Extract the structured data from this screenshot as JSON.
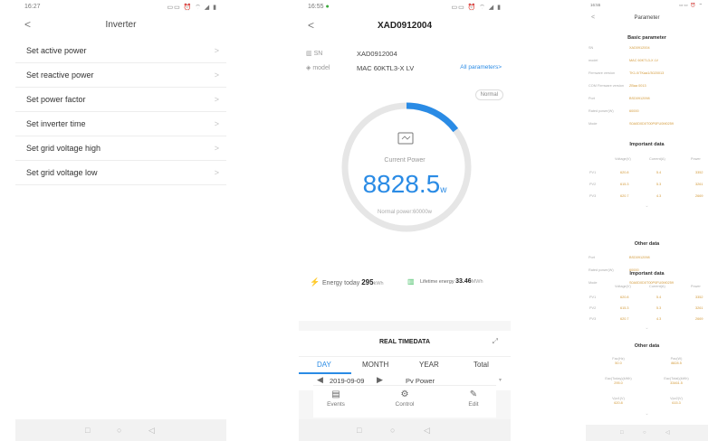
{
  "screen1": {
    "time": "16:27",
    "status_icons": "▭▭ ⏰ ⌔ ◢ ▮",
    "title": "Inverter",
    "back": "<",
    "menu": [
      {
        "label": "Set active power"
      },
      {
        "label": "Set reactive power"
      },
      {
        "label": "Set power factor"
      },
      {
        "label": "Set inverter time"
      },
      {
        "label": "Set grid voltage high"
      },
      {
        "label": "Set grid voltage low"
      }
    ],
    "chevron": ">"
  },
  "screen2": {
    "time": "16:55",
    "status_icons": "▭▭ ⏰ ⌔ ◢ ▮",
    "title": "XAD0912004",
    "back": "<",
    "sn_label": "SN",
    "sn_value": "XAD0912004",
    "model_label": "model",
    "model_value": "MAC 60KTL3-X LV",
    "all_params": "All parameters>",
    "status_badge": "Normal",
    "current_power_label": "Current Power",
    "current_power_value": "8828.5",
    "current_power_unit": "w",
    "normal_power": "Normal power:60000w",
    "gauge_fraction": 0.147,
    "energy_today_label": "Energy today",
    "energy_today_value": "295",
    "energy_today_unit": "kWh",
    "lifetime_label": "Lifetime energy",
    "lifetime_value": "33.46",
    "lifetime_unit": "MWh",
    "realtime_title": "REAL TIMEDATA",
    "tabs": [
      "DAY",
      "MONTH",
      "YEAR",
      "Total"
    ],
    "date": "2019-09-09",
    "series_select": "Pv Power",
    "toolbar": [
      {
        "label": "Events",
        "icon": "events-icon"
      },
      {
        "label": "Control",
        "icon": "gear-icon"
      },
      {
        "label": "Edit",
        "icon": "edit-icon"
      }
    ],
    "accent": "#2a8be5"
  },
  "screen3": {
    "time": "16:55",
    "status_icons": "▭▭ ⏰ ⌔",
    "title": "Parameter",
    "back": "<",
    "basic_title": "Basic parameter",
    "basic": [
      {
        "k": "SN",
        "v": "XAD0912004"
      },
      {
        "k": "model",
        "v": "MAC 60KTL3-X LV"
      },
      {
        "k": "Firmware version",
        "v": "TK1.0/TKaa1/3020013"
      },
      {
        "k": "COM Firmware version",
        "v": "ZBaa 0013"
      },
      {
        "k": "Port",
        "v": "BSD0912098"
      },
      {
        "k": "Rated power(W)",
        "v": "60000"
      },
      {
        "k": "Mode",
        "v": "S0A0D0D0T00P0FU0M0259"
      }
    ],
    "important_title": "Important data",
    "imp_headers": [
      "Voltage(V)",
      "Current(A)",
      "Power"
    ],
    "imp_rows": [
      {
        "name": "PV1",
        "v": "620.8",
        "c": "5.4",
        "p": "3352"
      },
      {
        "name": "PV2",
        "v": "615.3",
        "c": "5.3",
        "p": "3261"
      },
      {
        "name": "PV3",
        "v": "620.7",
        "c": "4.3",
        "p": "2669"
      }
    ],
    "other_title": "Other data",
    "other": [
      {
        "k": "Port",
        "v": "BSD0912098"
      },
      {
        "k": "Rated power(W)",
        "v": "60000"
      },
      {
        "k": "Mode",
        "v": "S0A0D0D0T00P0FU0M0259"
      }
    ],
    "important2_title": "Important data",
    "other2_title": "Other data",
    "grid": [
      {
        "k": "Fac(Hz)",
        "v": "50.0"
      },
      {
        "k": "Pac(W)",
        "v": "8828.5"
      },
      {
        "k": "Eac(Today)(kWh)",
        "v": "295.0"
      },
      {
        "k": "Eac(Total)(kWh)",
        "v": "33461.5"
      },
      {
        "k": "Vpv1(V)",
        "v": "620.8"
      },
      {
        "k": "Vpv2(V)",
        "v": "615.3"
      }
    ],
    "value_color": "#d39a3a"
  },
  "navbar": {
    "square": "□",
    "circle": "○",
    "back": "◁"
  }
}
